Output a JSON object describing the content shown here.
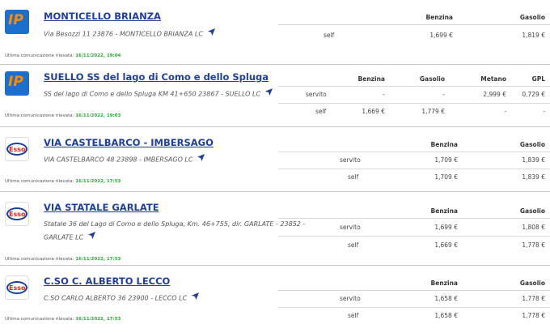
{
  "last_update_label": "Ultima comunicazione rilevata:",
  "stations": [
    {
      "brand": "IP",
      "name": "MONTICELLO BRIANZA",
      "address": "Via Besozzi 11 23876 - MONTICELLO BRIANZA LC",
      "updated": "16/11/2022, 19:04",
      "columns": [
        "Benzina",
        "Gasolio"
      ],
      "rows": [
        {
          "mode": "self",
          "prices": [
            "1,699 €",
            "1,819 €"
          ]
        }
      ]
    },
    {
      "brand": "IP",
      "name": "SUELLO SS del lago di Como e dello Spluga",
      "address": "SS del lago di Como e dello Spluga KM 41+650 23867 - SUELLO LC",
      "updated": "16/11/2022, 19:03",
      "columns": [
        "Benzina",
        "Gasolio",
        "Metano",
        "GPL"
      ],
      "rows": [
        {
          "mode": "servito",
          "prices": [
            "-",
            "-",
            "2,999 €",
            "0,729 €"
          ]
        },
        {
          "mode": "self",
          "prices": [
            "1,669 €",
            "1,779 €",
            "-",
            "-"
          ]
        }
      ]
    },
    {
      "brand": "ESSO",
      "name": "VIA CASTELBARCO - IMBERSAGO",
      "address": "VIA CASTELBARCO 48 23898 - IMBERSAGO LC",
      "updated": "16/11/2022, 17:53",
      "columns": [
        "Benzina",
        "Gasolio"
      ],
      "rows": [
        {
          "mode": "servito",
          "prices": [
            "1,709 €",
            "1,839 €"
          ]
        },
        {
          "mode": "self",
          "prices": [
            "1,709 €",
            "1,839 €"
          ]
        }
      ]
    },
    {
      "brand": "ESSO",
      "name": "VIA STATALE GARLATE",
      "address": "Statale 36 del Lago di Como e dello Spluga, Km. 46+755, dir. GARLATE - 23852 -",
      "address2": "GARLATE LC",
      "updated": "16/11/2022, 17:53",
      "columns": [
        "Benzina",
        "Gasolio"
      ],
      "rows": [
        {
          "mode": "servito",
          "prices": [
            "1,699 €",
            "1,808 €"
          ]
        },
        {
          "mode": "self",
          "prices": [
            "1,669 €",
            "1,778 €"
          ]
        }
      ]
    },
    {
      "brand": "ESSO",
      "name": "C.SO C. ALBERTO LECCO",
      "address": "C.SO CARLO ALBERTO 36 23900 - LECCO LC",
      "updated": "16/11/2022, 17:53",
      "columns": [
        "Benzina",
        "Gasolio"
      ],
      "rows": [
        {
          "mode": "servito",
          "prices": [
            "1,658 €",
            "1,778 €"
          ]
        },
        {
          "mode": "self",
          "prices": [
            "1,658 €",
            "1,778 €"
          ]
        }
      ]
    }
  ]
}
